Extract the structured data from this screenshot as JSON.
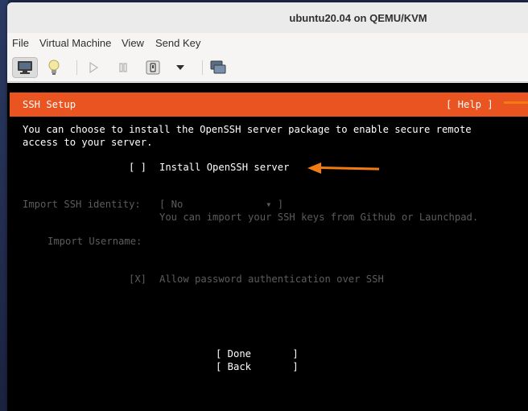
{
  "window": {
    "title": "ubuntu20.04 on QEMU/KVM"
  },
  "menubar": {
    "file": "File",
    "virtual_machine": "Virtual Machine",
    "view": "View",
    "send_key": "Send Key"
  },
  "toolbar": {
    "icons": [
      "monitor-icon",
      "lightbulb-icon",
      "play-icon",
      "pause-icon",
      "power-icon",
      "chevron-down-icon",
      "screenshot-icon"
    ]
  },
  "installer": {
    "header_title": "SSH Setup",
    "help_label": "[ Help ]",
    "description_line1": "You can choose to install the OpenSSH server package to enable secure remote",
    "description_line2": "access to your server.",
    "install_checkbox": "[ ]",
    "install_label": "Install OpenSSH server",
    "identity_label": "Import SSH identity:",
    "identity_select": "[ No              ▾ ]",
    "identity_help": "You can import your SSH keys from Github or Launchpad.",
    "username_label": "Import Username:",
    "password_checkbox": "[X]",
    "password_label": "Allow password authentication over SSH",
    "done_button": "[ Done       ]",
    "back_button": "[ Back       ]"
  },
  "colors": {
    "header_orange": "#e95420",
    "annotation_arrow": "#f27b14",
    "terminal_bg": "#000000",
    "disabled_text": "#5c5c5c"
  }
}
